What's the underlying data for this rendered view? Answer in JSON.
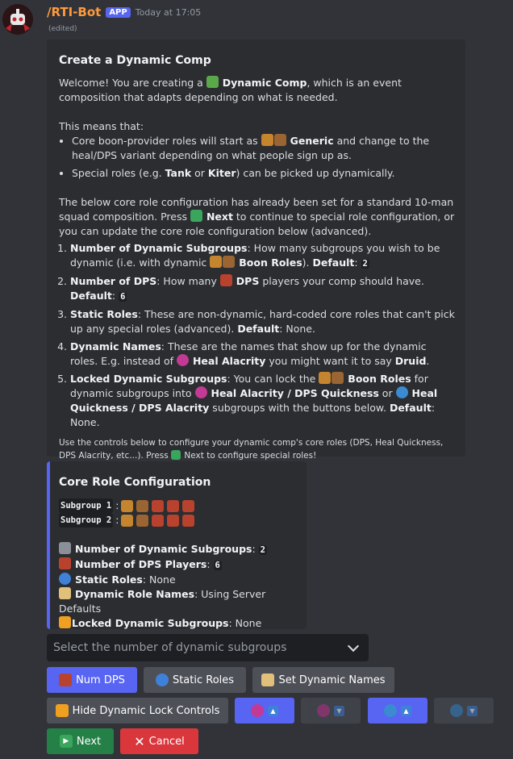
{
  "message": {
    "bot_name": "/RTI-Bot",
    "badge": "APP",
    "timestamp": "Today at 17:05",
    "edited": "(edited)"
  },
  "embed1": {
    "title": "Create a Dynamic Comp",
    "welcome_pre": "Welcome! You are creating a ",
    "welcome_bold": "Dynamic Comp",
    "welcome_post": ", which is an event composition that adapts depending on what is needed.",
    "means": "This means that:",
    "bullet1_pre": "Core boon-provider roles will start as ",
    "bullet1_bold": "Generic",
    "bullet1_post": " and change to the heal/DPS variant depending on what people sign up as.",
    "bullet2_pre": "Special roles (e.g. ",
    "bullet2_tank": "Tank",
    "bullet2_or": " or ",
    "bullet2_kiter": "Kiter",
    "bullet2_post": ") can be picked up dynamically.",
    "below_pre": "The below core role configuration has already been set for a standard 10-man squad composition. Press ",
    "below_next": "Next",
    "below_post": " to continue to special role configuration, or you can update the core role configuration below (advanced).",
    "item1_bold": "Number of Dynamic Subgroups",
    "item1_text": ": How many subgroups you wish to be dynamic (i.e. with dynamic ",
    "item1_boon": "Boon Roles",
    "item1_close": "). ",
    "item1_default": "Default",
    "item1_value": "2",
    "item2_bold": "Number of DPS",
    "item2_text": ": How many ",
    "item2_dps": "DPS",
    "item2_text2": " players your comp should have. ",
    "item2_default": "Default",
    "item2_value": "6",
    "item3_bold": "Static Roles",
    "item3_text": ": These are non-dynamic, hard-coded core roles that can't pick up any special roles (advanced). ",
    "item3_default": "Default",
    "item3_value": ": None.",
    "item4_bold": "Dynamic Names",
    "item4_text": ": These are the names that show up for the dynamic roles. E.g. instead of ",
    "item4_heal": "Heal Alacrity",
    "item4_text2": " you might want it to say ",
    "item4_druid": "Druid",
    "item4_end": ".",
    "item5_bold": "Locked Dynamic Subgroups",
    "item5_text": ": You can lock the ",
    "item5_boon": "Boon Roles",
    "item5_text2": " for dynamic subgroups into ",
    "item5_ha": "Heal Alacrity / DPS Quickness",
    "item5_or": " or ",
    "item5_hq": "Heal Quickness / DPS Alacrity",
    "item5_text3": " subgroups with the buttons below. ",
    "item5_default": "Default",
    "item5_value": ": None.",
    "footer_pre": "Use the controls below to configure your dynamic comp's core roles (DPS, Heal Quickness, DPS Alacrity, etc...). Press ",
    "footer_post": " Next to configure special roles!"
  },
  "embed2": {
    "title": "Core Role Configuration",
    "subgroup1": "Subgroup 1",
    "subgroup2": "Subgroup 2",
    "colon": ":",
    "f1_label": "Number of Dynamic Subgroups",
    "f1_value": "2",
    "f2_label": "Number of DPS Players",
    "f2_value": "6",
    "f3_label": "Static Roles",
    "f3_value": ": None",
    "f4_label": "Dynamic Role Names",
    "f4_value": ": Using Server Defaults",
    "f5_label": "Locked Dynamic Subgroups",
    "f5_value": ": None"
  },
  "select": {
    "placeholder": "Select the number of dynamic subgroups"
  },
  "buttons": {
    "num_dps": "Num DPS",
    "static_roles": "Static Roles",
    "set_names": "Set Dynamic Names",
    "hide_lock": "Hide Dynamic Lock Controls",
    "next": "Next",
    "cancel": "Cancel"
  },
  "colors": {
    "primary": "#5865f2",
    "secondary": "#4e5058",
    "success": "#248046",
    "danger": "#da373c",
    "bot_name": "#ff9a3c"
  }
}
